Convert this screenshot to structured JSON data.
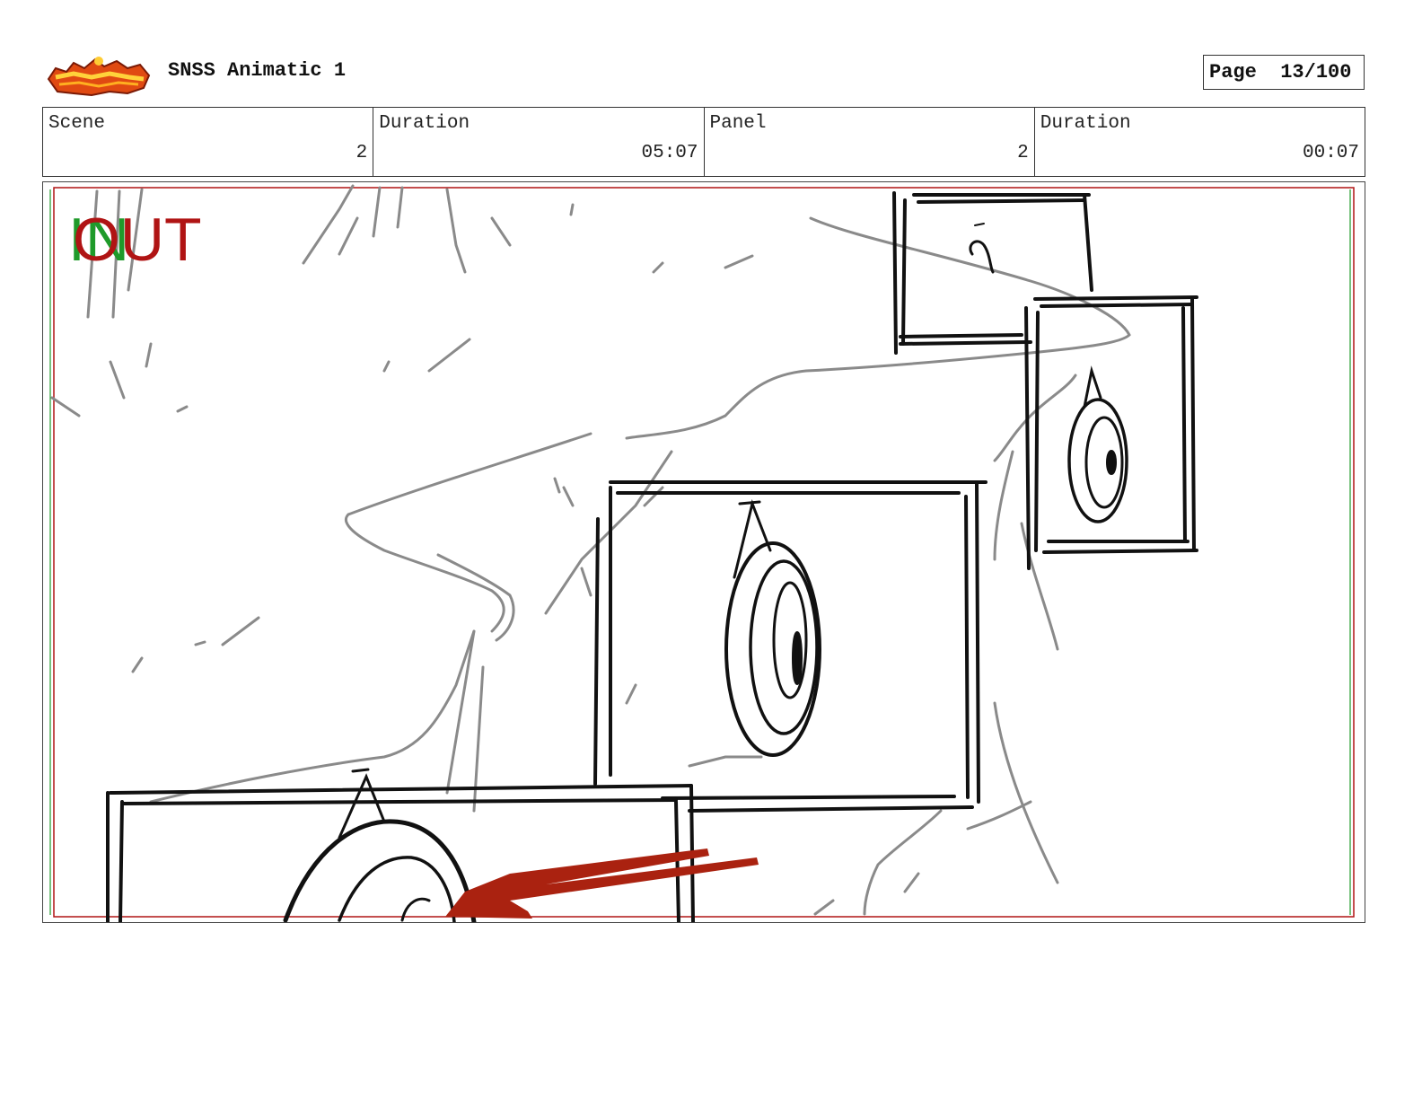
{
  "header": {
    "logo_name": "logo-icon",
    "title": "SNSS Animatic 1",
    "page_label": "Page",
    "page_value": "13/100"
  },
  "info": {
    "scene_label": "Scene",
    "scene_value": "2",
    "duration_label": "Duration",
    "duration_value": "05:07",
    "panel_label": "Panel",
    "panel_value": "2",
    "panel_duration_label": "Duration",
    "panel_duration_value": "00:07"
  },
  "frame": {
    "in_label": "IN",
    "out_label": "OUT"
  },
  "colors": {
    "in_green": "#1f9a2a",
    "out_red": "#b01414",
    "arrow_red": "#aa2210",
    "sketch_gray": "#8a8a8a",
    "ink": "#111111"
  }
}
